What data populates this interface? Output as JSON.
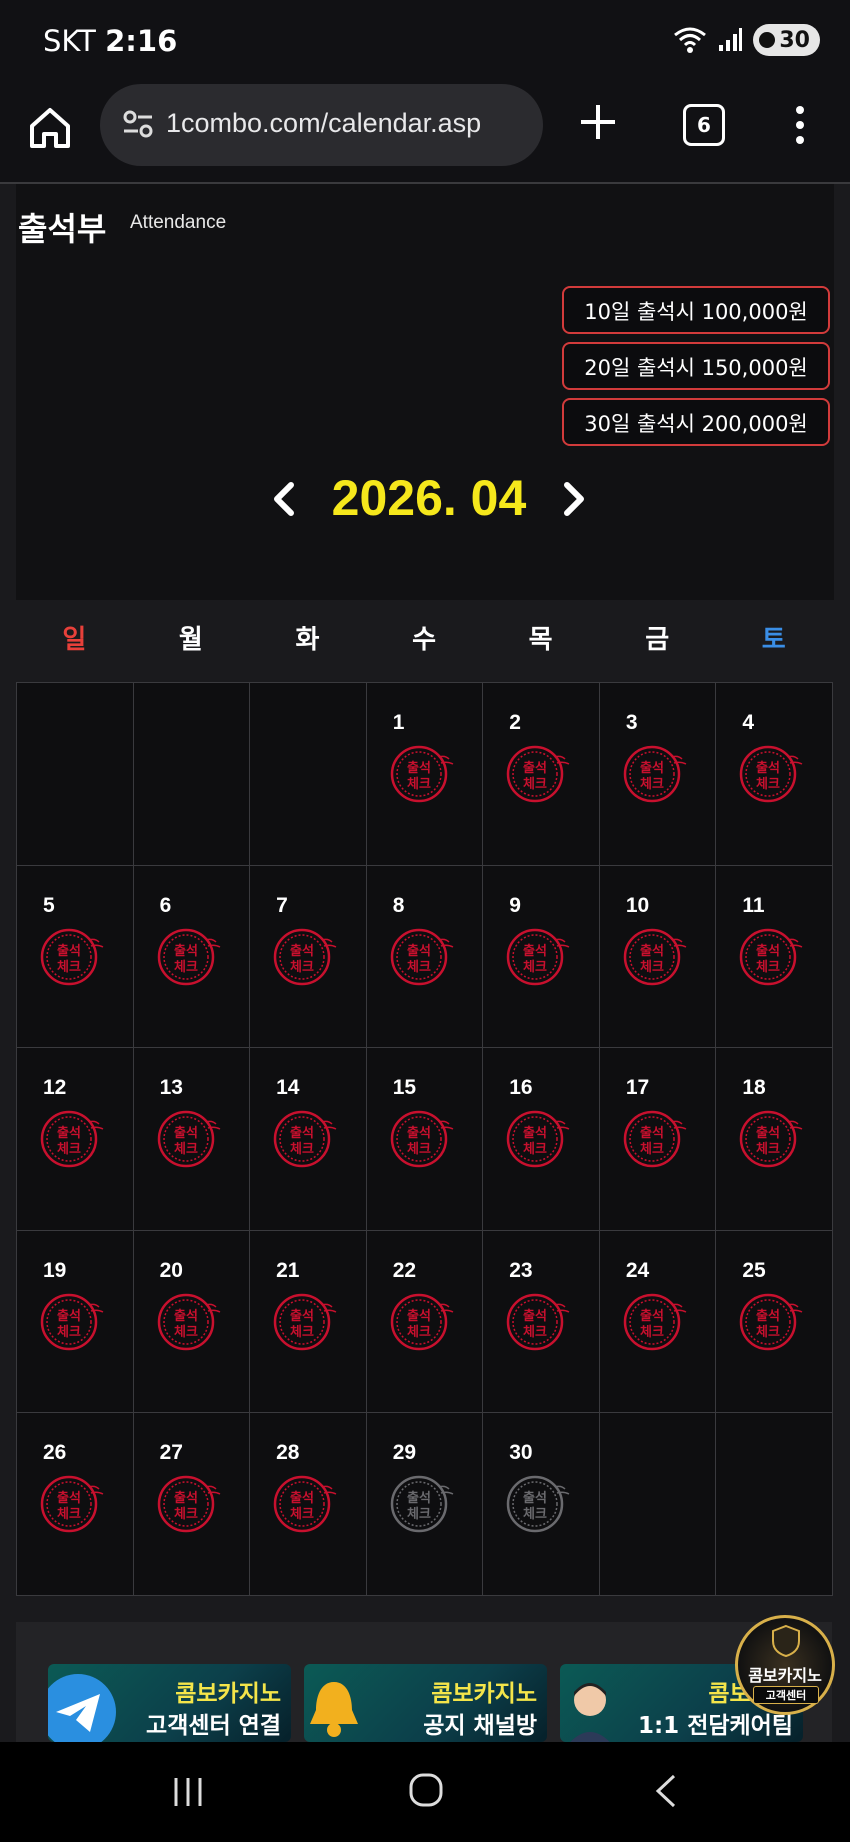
{
  "status_bar": {
    "carrier": "SKT",
    "time": "2:16",
    "battery": "30"
  },
  "browser": {
    "url": "1combo.com/calendar.asp",
    "tab_count": "6"
  },
  "header": {
    "title": "출석부",
    "subtitle": "Attendance"
  },
  "rewards": [
    "10일 출석시 100,000원",
    "20일 출석시 150,000원",
    "30일 출석시 200,000원"
  ],
  "calendar": {
    "month_label": "2026. 04",
    "weekdays": [
      "일",
      "월",
      "화",
      "수",
      "목",
      "금",
      "토"
    ],
    "weekday_colors": [
      "#e8403a",
      "#ffffff",
      "#ffffff",
      "#ffffff",
      "#ffffff",
      "#ffffff",
      "#3a8ee6"
    ],
    "first_weekday_index": 3,
    "days_in_month": 30,
    "stamp_text": [
      "출석",
      "체크"
    ],
    "checked_days": [
      1,
      2,
      3,
      4,
      5,
      6,
      7,
      8,
      9,
      10,
      11,
      12,
      13,
      14,
      15,
      16,
      17,
      18,
      19,
      20,
      21,
      22,
      23,
      24,
      25,
      26,
      27,
      28
    ],
    "checked_color": "#c8102e",
    "unchecked_color": "#6a6a6e"
  },
  "banners": [
    {
      "line1": "콤보카지노",
      "line2": "고객센터 연결"
    },
    {
      "line1": "콤보카지노",
      "line2": "공지 채널방"
    },
    {
      "line1": "콤보카지",
      "line2": "1:1 전담케어팀"
    }
  ],
  "floating": {
    "label": "콤보카지노",
    "sub": "고객센터"
  }
}
